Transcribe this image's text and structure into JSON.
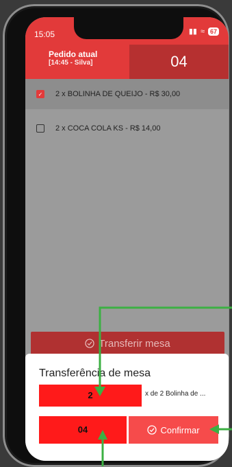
{
  "status": {
    "time": "15:05",
    "battery": "67"
  },
  "header": {
    "order_title": "Pedido atual",
    "order_sub": "[14:45 - Silva]",
    "table_number": "04"
  },
  "items": [
    {
      "label": "2 x BOLINHA DE QUEIJO - R$ 30,00",
      "checked": true
    },
    {
      "label": "2 x COCA COLA KS - R$ 14,00",
      "checked": false
    }
  ],
  "transfer_button": {
    "label": "Transferir mesa"
  },
  "sheet": {
    "title": "Transferência de mesa",
    "quantity": "2",
    "quantity_desc": "x de 2 Bolinha de ...",
    "destination": "04",
    "confirm_label": "Confirmar"
  },
  "colors": {
    "primary": "#e23a3a",
    "highlight": "#ff1a1a",
    "annotation": "#3cb043"
  }
}
